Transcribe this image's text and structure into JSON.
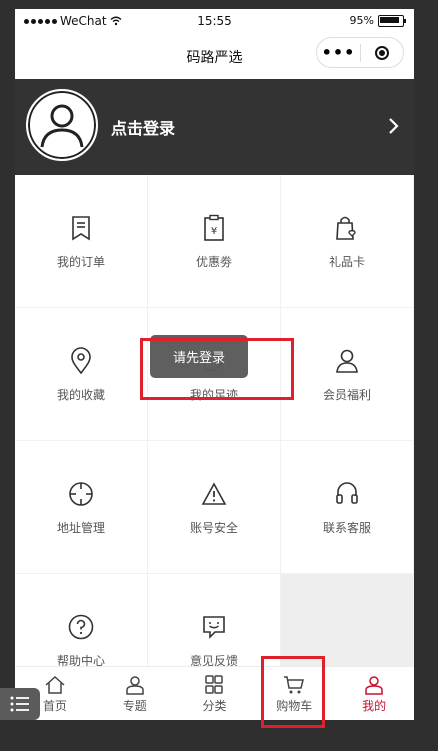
{
  "status": {
    "carrier": "WeChat",
    "time": "15:55",
    "battery": "95%"
  },
  "nav": {
    "title": "码路严选",
    "more": "•••"
  },
  "profile": {
    "login_text": "点击登录"
  },
  "grid": [
    {
      "label": "我的订单",
      "icon": "order-icon"
    },
    {
      "label": "优惠劵",
      "icon": "coupon-icon"
    },
    {
      "label": "礼品卡",
      "icon": "gift-card-icon"
    },
    {
      "label": "我的收藏",
      "icon": "location-pin-icon"
    },
    {
      "label": "我的足迹",
      "icon": "footprint-icon"
    },
    {
      "label": "会员福利",
      "icon": "member-icon"
    },
    {
      "label": "地址管理",
      "icon": "crosshair-icon"
    },
    {
      "label": "账号安全",
      "icon": "warning-icon"
    },
    {
      "label": "联系客服",
      "icon": "headset-icon"
    },
    {
      "label": "帮助中心",
      "icon": "help-icon"
    },
    {
      "label": "意见反馈",
      "icon": "feedback-icon"
    }
  ],
  "toast": {
    "text": "请先登录"
  },
  "tabs": [
    {
      "label": "首页",
      "icon": "home-icon"
    },
    {
      "label": "专题",
      "icon": "topic-icon"
    },
    {
      "label": "分类",
      "icon": "category-icon"
    },
    {
      "label": "购物车",
      "icon": "cart-icon"
    },
    {
      "label": "我的",
      "icon": "profile-icon"
    }
  ],
  "colors": {
    "accent": "#c8102e",
    "header_bg": "#333333",
    "highlight": "#e0202a"
  }
}
